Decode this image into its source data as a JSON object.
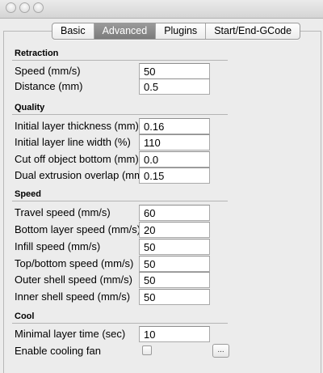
{
  "window": {
    "title": "",
    "traffic_lights": [
      "close",
      "minimize",
      "zoom"
    ]
  },
  "tabs": [
    {
      "label": "Basic",
      "active": false
    },
    {
      "label": "Advanced",
      "active": true
    },
    {
      "label": "Plugins",
      "active": false
    },
    {
      "label": "Start/End-GCode",
      "active": false
    }
  ],
  "sections": {
    "retraction": {
      "header": "Retraction",
      "fields": [
        {
          "label": "Speed (mm/s)",
          "value": "50"
        },
        {
          "label": "Distance (mm)",
          "value": "0.5"
        }
      ]
    },
    "quality": {
      "header": "Quality",
      "fields": [
        {
          "label": "Initial layer thickness (mm)",
          "value": "0.16"
        },
        {
          "label": "Initial layer line width (%)",
          "value": "110"
        },
        {
          "label": "Cut off object bottom (mm)",
          "value": "0.0"
        },
        {
          "label": "Dual extrusion overlap (mm)",
          "value": "0.15"
        }
      ]
    },
    "speed": {
      "header": "Speed",
      "fields": [
        {
          "label": "Travel speed (mm/s)",
          "value": "60"
        },
        {
          "label": "Bottom layer speed (mm/s)",
          "value": "20"
        },
        {
          "label": "Infill speed (mm/s)",
          "value": "50"
        },
        {
          "label": "Top/bottom speed (mm/s)",
          "value": "50"
        },
        {
          "label": "Outer shell speed (mm/s)",
          "value": "50"
        },
        {
          "label": "Inner shell speed (mm/s)",
          "value": "50"
        }
      ]
    },
    "cool": {
      "header": "Cool",
      "fields": [
        {
          "label": "Minimal layer time (sec)",
          "value": "10"
        }
      ],
      "fan": {
        "label": "Enable cooling fan",
        "checked": false,
        "more_label": "..."
      }
    }
  },
  "colors": {
    "window_bg": "#ececec",
    "active_tab_bg": "#8a8a8a",
    "active_tab_text": "#ffffff",
    "field_bg": "#ffffff"
  }
}
